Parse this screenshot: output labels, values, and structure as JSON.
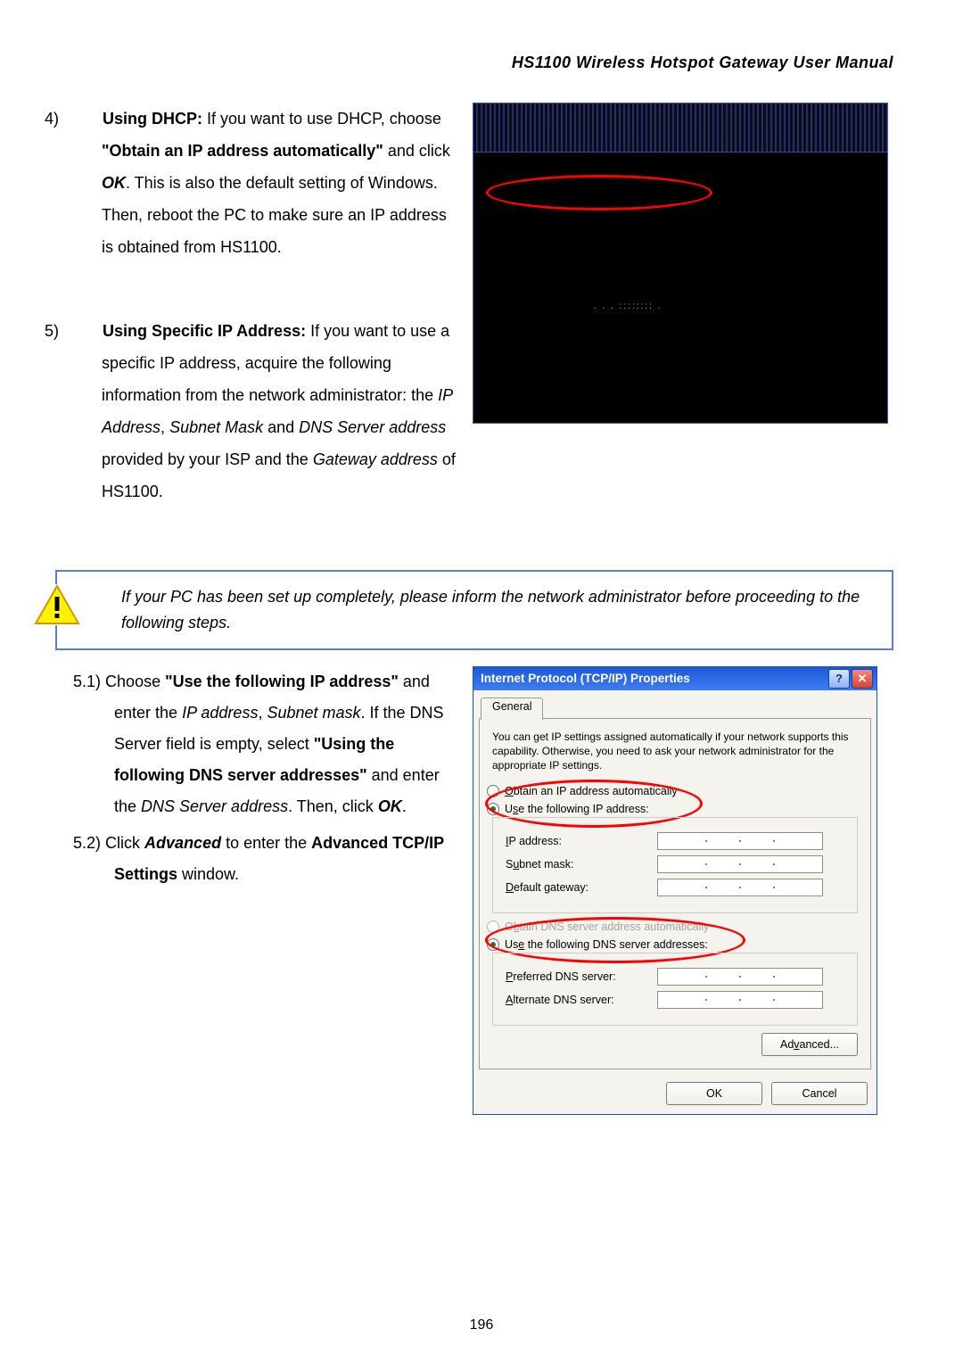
{
  "header": {
    "title": "HS1100 Wireless Hotspot Gateway User Manual"
  },
  "list": {
    "item4": {
      "marker": "4)",
      "lead_bold": "Using DHCP: ",
      "p1": "If you want to use DHCP, choose ",
      "q1": "\"Obtain an IP address automatically\"",
      "p2": " and click ",
      "ok": "OK",
      "p3": ". This is also the default setting of Windows. Then, reboot the PC to make sure an IP address is obtained from HS1100."
    },
    "item5": {
      "marker": "5)",
      "lead_bold": "Using Specific IP Address: ",
      "p1": "If you want to use a specific IP address, acquire the following information from the network administrator: the ",
      "i1": "IP Address",
      "c1": ", ",
      "i2": "Subnet Mask",
      "c2": " and ",
      "i3": "DNS Server address",
      "p2": " provided by your ISP and the ",
      "i4": "Gateway address",
      "p3": " of HS1100."
    }
  },
  "figure1": {
    "noise": ". . .  :::::::: ."
  },
  "callout": {
    "text": "If your PC has been set up completely, please inform the network administrator before proceeding to the following steps."
  },
  "sub": {
    "s1": {
      "marker": "5.1)",
      "t1": "Choose ",
      "q1": "\"Use the following IP address\"",
      "t2": " and enter the ",
      "i1": "IP address",
      "c1": ", ",
      "i2": "Subnet mask",
      "t3": ". If the DNS Server field is empty, select ",
      "q2": "\"Using the following DNS server addresses\"",
      "t4": " and enter the ",
      "i3": "DNS Server address",
      "t5": ". Then, click ",
      "ok": "OK",
      "dot": "."
    },
    "s2": {
      "marker": "5.2)",
      "t1": "Click ",
      "b1": "Advanced",
      "t2": " to enter the ",
      "b2": "Advanced TCP/IP Settings",
      "t3": " window."
    }
  },
  "dialog": {
    "title": "Internet Protocol (TCP/IP) Properties",
    "help_glyph": "?",
    "close_glyph": "✕",
    "tab_label": "General",
    "desc": "You can get IP settings assigned automatically if your network supports this capability. Otherwise, you need to ask your network administrator for the appropriate IP settings.",
    "radio_auto_pre": "O",
    "radio_auto_post": "btain an IP address automatically",
    "radio_use_pre": "U",
    "radio_use_mid": "s",
    "radio_use_post": "e the following IP address:",
    "ip_pre": "I",
    "ip_label": "P address:",
    "sub_pre": "S",
    "sub_mid": "u",
    "sub_post": "bnet mask:",
    "gw_pre": "D",
    "gw_label": "efault gateway:",
    "radio_dns_auto_pre": "O",
    "radio_dns_auto_mid": "b",
    "radio_dns_auto_post": "tain DNS server address automatically",
    "radio_dns_use_pre": "Us",
    "radio_dns_use_mid": "e",
    "radio_dns_use_post": " the following DNS server addresses:",
    "pdns_pre": "P",
    "pdns_label": "referred DNS server:",
    "adns_pre": "A",
    "adns_label": "lternate DNS server:",
    "adv_pre": "Ad",
    "adv_mid": "v",
    "adv_post": "anced...",
    "ok": "OK",
    "cancel": "Cancel"
  },
  "page_number": "196"
}
